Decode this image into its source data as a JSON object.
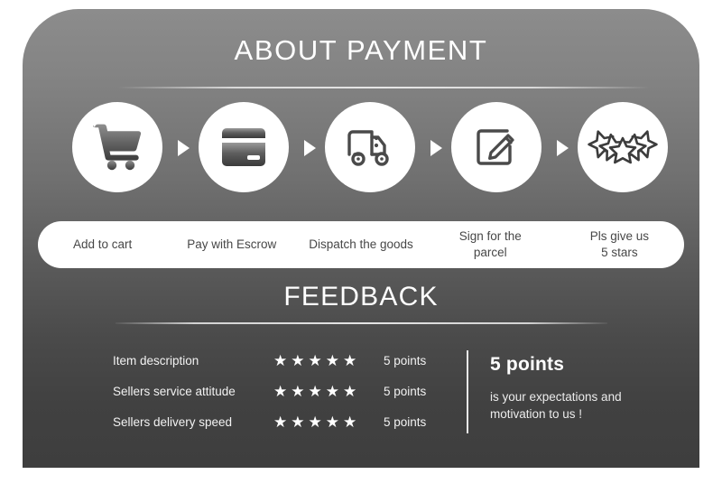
{
  "card": {
    "background_top_color": "#8c8c8c",
    "background_bottom_color": "#3e3e3e"
  },
  "payment": {
    "title": "ABOUT PAYMENT",
    "steps": [
      {
        "icon": "shopping-cart-icon",
        "label": "Add to cart"
      },
      {
        "icon": "credit-card-icon",
        "label": "Pay with Escrow"
      },
      {
        "icon": "delivery-truck-icon",
        "label": "Dispatch the goods"
      },
      {
        "icon": "sign-document-icon",
        "label": "Sign for the\nparcel"
      },
      {
        "icon": "stars-icon",
        "label": "Pls give us\n5 stars"
      }
    ],
    "arrow_icon": "triangle-right-icon",
    "circle_color": "#ffffff",
    "label_bar_color": "#ffffff"
  },
  "feedback": {
    "title": "FEEDBACK",
    "star_glyph": "★",
    "max_stars": 5,
    "rows": [
      {
        "label": "Item description",
        "stars": 5,
        "points": "5 points"
      },
      {
        "label": "Sellers service attitude",
        "stars": 5,
        "points": "5 points"
      },
      {
        "label": "Sellers delivery speed",
        "stars": 5,
        "points": "5 points"
      }
    ],
    "summary": {
      "heading": "5 points",
      "body": "is your expectations and motivation to us !"
    }
  }
}
